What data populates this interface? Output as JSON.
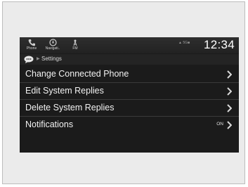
{
  "statusbar": {
    "buttons": [
      {
        "label": "Phone",
        "icon": "phone-icon"
      },
      {
        "label": "Navigati..",
        "icon": "navigation-icon"
      },
      {
        "label": "FM",
        "icon": "radio-icon"
      }
    ],
    "signal_text": "▲ 5G■",
    "clock": "12:34"
  },
  "breadcrumb": {
    "icon": "message-bubble-icon",
    "text": "Settings"
  },
  "menu": {
    "items": [
      {
        "label": "Change Connected Phone",
        "state": ""
      },
      {
        "label": "Edit System Replies",
        "state": ""
      },
      {
        "label": "Delete System Replies",
        "state": ""
      },
      {
        "label": "Notifications",
        "state": "ON"
      }
    ]
  },
  "colors": {
    "screen_bg": "#1b1b1b",
    "text": "#f2f2f2",
    "frame": "#ebebeb"
  }
}
